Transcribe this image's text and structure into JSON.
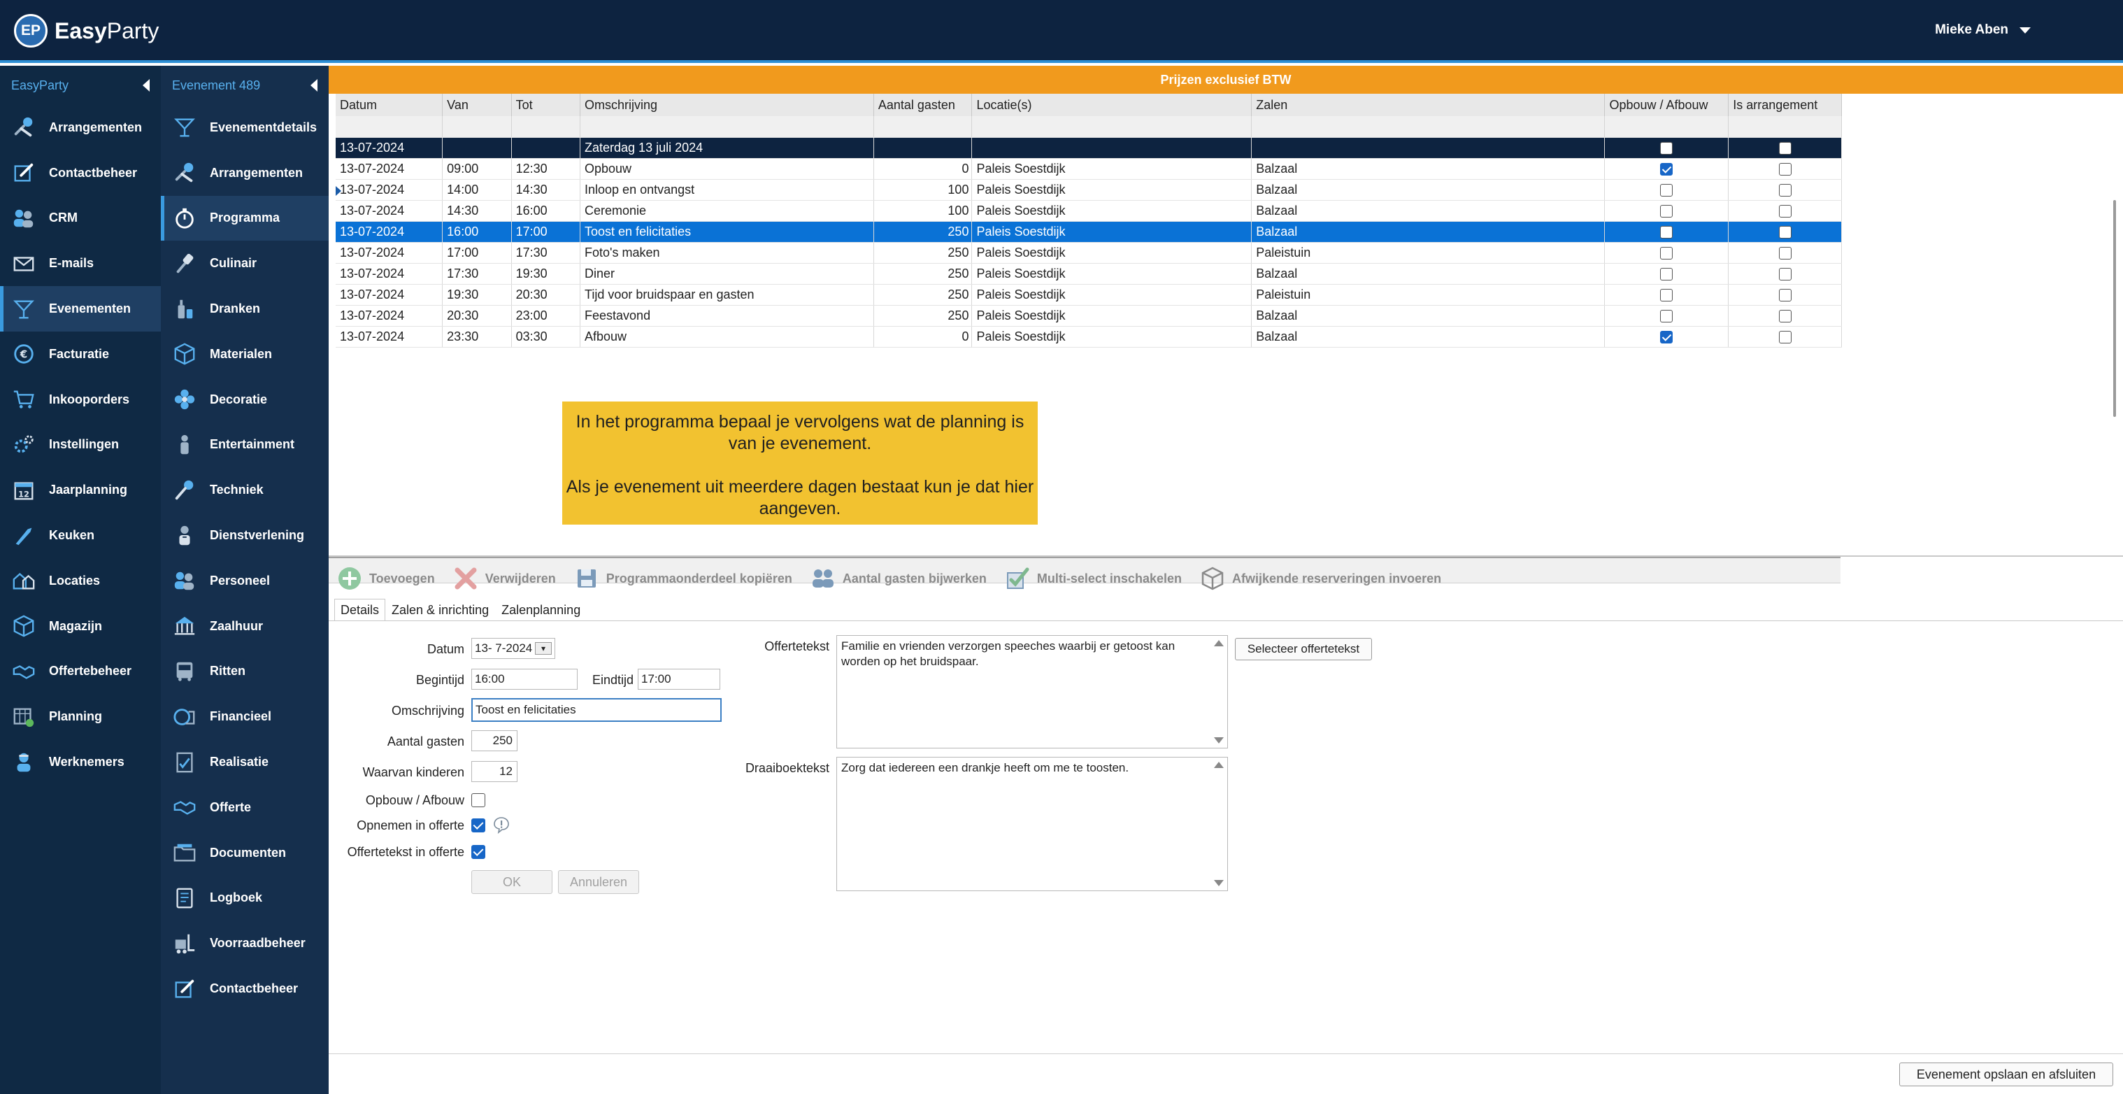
{
  "app": {
    "logo_badge": "EP",
    "logo_bold": "Easy",
    "logo_light": "Party",
    "user_name": "Mieke Aben"
  },
  "sidebar1": {
    "title": "EasyParty",
    "items": [
      {
        "label": "Arrangementen",
        "icon": "tools-icon"
      },
      {
        "label": "Contactbeheer",
        "icon": "edit-icon"
      },
      {
        "label": "CRM",
        "icon": "people-icon"
      },
      {
        "label": "E-mails",
        "icon": "envelope-icon"
      },
      {
        "label": "Evenementen",
        "icon": "cocktail-icon"
      },
      {
        "label": "Facturatie",
        "icon": "invoice-icon"
      },
      {
        "label": "Inkooporders",
        "icon": "cart-icon"
      },
      {
        "label": "Instellingen",
        "icon": "gear-icon"
      },
      {
        "label": "Jaarplanning",
        "icon": "calendar-icon"
      },
      {
        "label": "Keuken",
        "icon": "knife-icon"
      },
      {
        "label": "Locaties",
        "icon": "buildings-icon"
      },
      {
        "label": "Magazijn",
        "icon": "box-icon"
      },
      {
        "label": "Offertebeheer",
        "icon": "handshake-icon"
      },
      {
        "label": "Planning",
        "icon": "planning-icon"
      },
      {
        "label": "Werknemers",
        "icon": "worker-icon"
      }
    ]
  },
  "sidebar2": {
    "title": "Evenement 489",
    "items": [
      {
        "label": "Evenementdetails",
        "icon": "cocktail-icon"
      },
      {
        "label": "Arrangementen",
        "icon": "tools-icon"
      },
      {
        "label": "Programma",
        "icon": "stopwatch-icon"
      },
      {
        "label": "Culinair",
        "icon": "spatula-icon"
      },
      {
        "label": "Dranken",
        "icon": "bottle-icon"
      },
      {
        "label": "Materialen",
        "icon": "box-icon"
      },
      {
        "label": "Decoratie",
        "icon": "flower-icon"
      },
      {
        "label": "Entertainment",
        "icon": "juggler-icon"
      },
      {
        "label": "Techniek",
        "icon": "microphone-icon"
      },
      {
        "label": "Dienstverlening",
        "icon": "waiter-icon"
      },
      {
        "label": "Personeel",
        "icon": "people-icon"
      },
      {
        "label": "Zaalhuur",
        "icon": "venue-icon"
      },
      {
        "label": "Ritten",
        "icon": "bus-icon"
      },
      {
        "label": "Financieel",
        "icon": "money-icon"
      },
      {
        "label": "Realisatie",
        "icon": "report-icon"
      },
      {
        "label": "Offerte",
        "icon": "handshake-icon"
      },
      {
        "label": "Documenten",
        "icon": "folder-icon"
      },
      {
        "label": "Logboek",
        "icon": "logbook-icon"
      },
      {
        "label": "Voorraadbeheer",
        "icon": "forklift-icon"
      },
      {
        "label": "Contactbeheer",
        "icon": "edit-icon"
      }
    ]
  },
  "banner": "Prijzen exclusief BTW",
  "grid": {
    "columns": [
      "Datum",
      "Van",
      "Tot",
      "Omschrijving",
      "Aantal gasten",
      "Locatie(s)",
      "Zalen",
      "Opbouw / Afbouw",
      "Is arrangement"
    ],
    "day_row": {
      "datum": "13-07-2024",
      "omschrijving": "Zaterdag 13 juli 2024"
    },
    "rows": [
      {
        "datum": "13-07-2024",
        "van": "09:00",
        "tot": "12:30",
        "omschrijving": "Opbouw",
        "gasten": "0",
        "locatie": "Paleis Soestdijk",
        "zaal": "Balzaal",
        "opbouw": true,
        "arrangement": false
      },
      {
        "datum": "13-07-2024",
        "van": "14:00",
        "tot": "14:30",
        "omschrijving": "Inloop en ontvangst",
        "gasten": "100",
        "locatie": "Paleis Soestdijk",
        "zaal": "Balzaal",
        "opbouw": false,
        "arrangement": false
      },
      {
        "datum": "13-07-2024",
        "van": "14:30",
        "tot": "16:00",
        "omschrijving": "Ceremonie",
        "gasten": "100",
        "locatie": "Paleis Soestdijk",
        "zaal": "Balzaal",
        "opbouw": false,
        "arrangement": false
      },
      {
        "datum": "13-07-2024",
        "van": "16:00",
        "tot": "17:00",
        "omschrijving": "Toost en felicitaties",
        "gasten": "250",
        "locatie": "Paleis Soestdijk",
        "zaal": "Balzaal",
        "opbouw": false,
        "arrangement": false
      },
      {
        "datum": "13-07-2024",
        "van": "17:00",
        "tot": "17:30",
        "omschrijving": "Foto's maken",
        "gasten": "250",
        "locatie": "Paleis Soestdijk",
        "zaal": "Paleistuin",
        "opbouw": false,
        "arrangement": false
      },
      {
        "datum": "13-07-2024",
        "van": "17:30",
        "tot": "19:30",
        "omschrijving": "Diner",
        "gasten": "250",
        "locatie": "Paleis Soestdijk",
        "zaal": "Balzaal",
        "opbouw": false,
        "arrangement": false
      },
      {
        "datum": "13-07-2024",
        "van": "19:30",
        "tot": "20:30",
        "omschrijving": "Tijd voor bruidspaar en gasten",
        "gasten": "250",
        "locatie": "Paleis Soestdijk",
        "zaal": "Paleistuin",
        "opbouw": false,
        "arrangement": false
      },
      {
        "datum": "13-07-2024",
        "van": "20:30",
        "tot": "23:00",
        "omschrijving": "Feestavond",
        "gasten": "250",
        "locatie": "Paleis Soestdijk",
        "zaal": "Balzaal",
        "opbouw": false,
        "arrangement": false
      },
      {
        "datum": "13-07-2024",
        "van": "23:30",
        "tot": "03:30",
        "omschrijving": "Afbouw",
        "gasten": "0",
        "locatie": "Paleis Soestdijk",
        "zaal": "Balzaal",
        "opbouw": true,
        "arrangement": false
      }
    ]
  },
  "tooltip": {
    "line1": "In het programma bepaal je vervolgens wat de planning is van je evenement.",
    "line2": "Als je evenement uit meerdere dagen bestaat kun je dat hier aangeven."
  },
  "toolbar": {
    "add": "Toevoegen",
    "delete": "Verwijderen",
    "copy": "Programmaonderdeel kopiëren",
    "guests": "Aantal gasten bijwerken",
    "multiselect": "Multi-select inschakelen",
    "reservations": "Afwijkende reserveringen invoeren"
  },
  "tabs": [
    "Details",
    "Zalen & inrichting",
    "Zalenplanning"
  ],
  "form": {
    "datum_label": "Datum",
    "datum_value": "13- 7-2024",
    "begintijd_label": "Begintijd",
    "begintijd_value": "16:00",
    "eindtijd_label": "Eindtijd",
    "eindtijd_value": "17:00",
    "omschrijving_label": "Omschrijving",
    "omschrijving_value": "Toost en felicitaties",
    "gasten_label": "Aantal gasten",
    "gasten_value": "250",
    "kinderen_label": "Waarvan kinderen",
    "kinderen_value": "12",
    "opbouw_label": "Opbouw / Afbouw",
    "offerte_label": "Opnemen in offerte",
    "offertetekst_cb_label": "Offertetekst in offerte",
    "ok": "OK",
    "cancel": "Annuleren",
    "offertetekst_label": "Offertetekst",
    "offertetekst_value": "Familie en vrienden verzorgen speeches waarbij er getoost kan worden op het bruidspaar.",
    "select_offertetekst": "Selecteer offertetekst",
    "draaiboek_label": "Draaiboektekst",
    "draaiboek_value": "Zorg dat iedereen een drankje heeft om me te toosten."
  },
  "footer": {
    "save_close": "Evenement opslaan en afsluiten"
  },
  "colors": {
    "topbar": "#0d2340",
    "sidebar1": "#0f2944",
    "sidebar2": "#152f4d",
    "banner": "#f19a1d",
    "selected_row": "#0a72d6",
    "tooltip": "#f2c230",
    "accent": "#3a9be0"
  }
}
